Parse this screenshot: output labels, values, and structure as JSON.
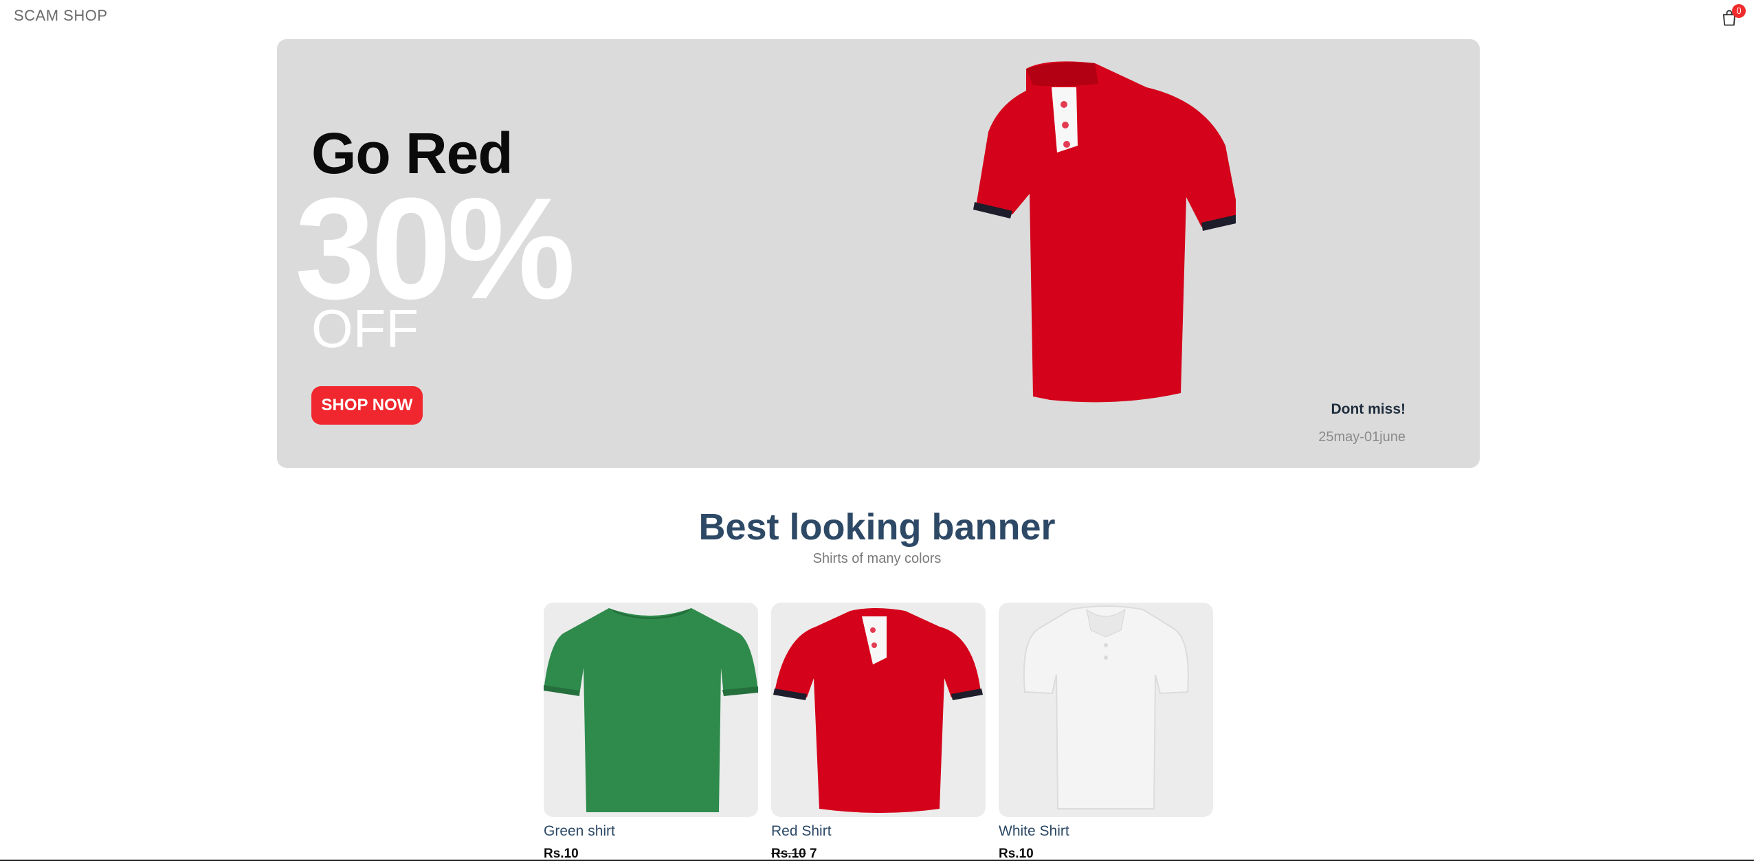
{
  "navbar": {
    "logo": "SCAM SHOP",
    "cart_count": "0",
    "cart_icon": "shopping-bag-icon"
  },
  "hero": {
    "subtitle": "Go Red",
    "big_text": "30%",
    "off_text": "OFF",
    "button_label": "SHOP NOW",
    "note": "Dont miss!",
    "date_range": "25may-01june",
    "background": "#dbdbdb",
    "accent": "#f0272e"
  },
  "section": {
    "title": "Best looking banner",
    "subtitle": "Shirts of many colors"
  },
  "products": [
    {
      "name": "Green shirt",
      "price": "Rs.10",
      "old_price": "",
      "new_price": "",
      "color": "#2e8b4c"
    },
    {
      "name": "Red Shirt",
      "price": "",
      "old_price": "Rs.10",
      "new_price": "7",
      "color": "#d4021a"
    },
    {
      "name": "White Shirt",
      "price": "Rs.10",
      "old_price": "",
      "new_price": "",
      "color": "#f1f1f1"
    }
  ]
}
